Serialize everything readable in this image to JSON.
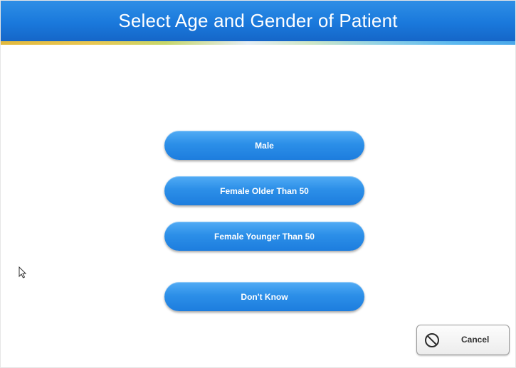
{
  "header": {
    "title": "Select Age and Gender of Patient"
  },
  "options": [
    {
      "label": "Male"
    },
    {
      "label": "Female Older Than 50"
    },
    {
      "label": "Female Younger Than 50"
    },
    {
      "label": "Don't Know"
    }
  ],
  "cancel": {
    "label": "Cancel",
    "icon": "no-entry-icon"
  },
  "colors": {
    "header_blue": "#1a79dc",
    "button_blue": "#2c8fe8",
    "button_text": "#ffffff",
    "cancel_bg": "#f4f4f4"
  }
}
